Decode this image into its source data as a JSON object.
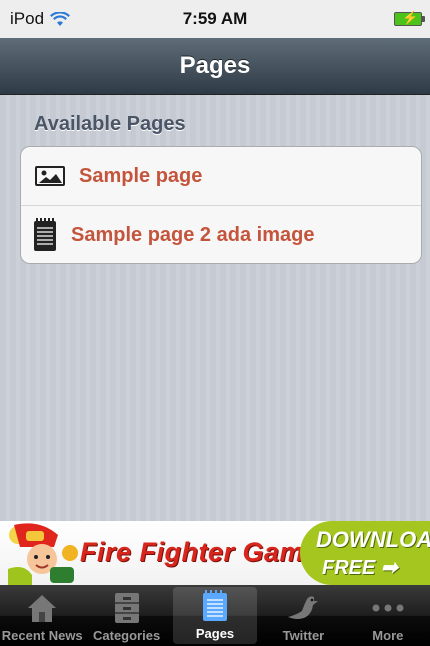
{
  "status_bar": {
    "carrier": "iPod",
    "time": "7:59 AM"
  },
  "nav": {
    "title": "Pages"
  },
  "section": {
    "header": "Available Pages"
  },
  "pages": [
    {
      "label": "Sample page",
      "icon": "image-icon"
    },
    {
      "label": "Sample page 2 ada image",
      "icon": "notepad-icon"
    }
  ],
  "ad": {
    "title": "Fire Fighter Game",
    "cta_line1": "DOWNLOAD",
    "cta_line2": "FREE ➡"
  },
  "tabs": [
    {
      "label": "Recent News",
      "icon": "home-icon",
      "selected": false
    },
    {
      "label": "Categories",
      "icon": "cabinet-icon",
      "selected": false
    },
    {
      "label": "Pages",
      "icon": "notepad-icon",
      "selected": true
    },
    {
      "label": "Twitter",
      "icon": "bird-icon",
      "selected": false
    },
    {
      "label": "More",
      "icon": "more-icon",
      "selected": false
    }
  ],
  "colors": {
    "accent_text": "#c4553c",
    "nav_bar": "#3d4a55",
    "battery": "#4cc31a",
    "ad_green": "#a4c61f"
  }
}
